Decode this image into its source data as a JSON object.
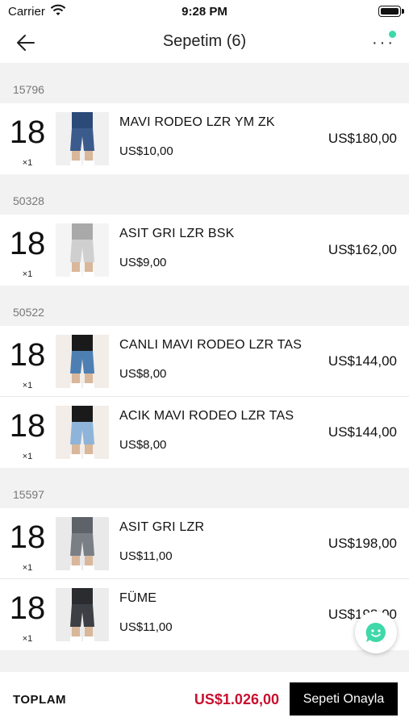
{
  "status_bar": {
    "carrier": "Carrier",
    "time": "9:28 PM"
  },
  "nav": {
    "title": "Sepetim  (6)"
  },
  "groups": [
    {
      "code": "15796",
      "items": [
        {
          "size": "18",
          "qty": "×1",
          "name": "MAVI RODEO LZR YM ZK",
          "unit_price": "US$10,00",
          "total": "US$180,00",
          "image": "product-photo"
        }
      ]
    },
    {
      "code": "50328",
      "items": [
        {
          "size": "18",
          "qty": "×1",
          "name": "ASIT GRI LZR BSK",
          "unit_price": "US$9,00",
          "total": "US$162,00",
          "image": "product-photo"
        }
      ]
    },
    {
      "code": "50522",
      "items": [
        {
          "size": "18",
          "qty": "×1",
          "name": "CANLI MAVI RODEO LZR TAS",
          "unit_price": "US$8,00",
          "total": "US$144,00",
          "image": "product-photo"
        },
        {
          "size": "18",
          "qty": "×1",
          "name": "ACIK MAVI RODEO LZR TAS",
          "unit_price": "US$8,00",
          "total": "US$144,00",
          "image": "product-photo"
        }
      ]
    },
    {
      "code": "15597",
      "items": [
        {
          "size": "18",
          "qty": "×1",
          "name": "ASIT GRI LZR",
          "unit_price": "US$11,00",
          "total": "US$198,00",
          "image": "product-photo"
        },
        {
          "size": "18",
          "qty": "×1",
          "name": "FÜME",
          "unit_price": "US$11,00",
          "total": "US$198,00",
          "image": "product-photo"
        }
      ]
    }
  ],
  "footer": {
    "total_label": "TOPLAM",
    "total_amount": "US$1.026,00",
    "confirm_label": "Sepeti Onayla"
  },
  "colors": {
    "accent_red": "#c8102e",
    "notify_green": "#3fd8a8",
    "button_black": "#000000"
  },
  "icons": {
    "back": "arrow-left-icon",
    "more": "more-dots-icon",
    "chat": "chat-bubble-icon",
    "wifi": "wifi-icon",
    "battery": "battery-icon"
  }
}
